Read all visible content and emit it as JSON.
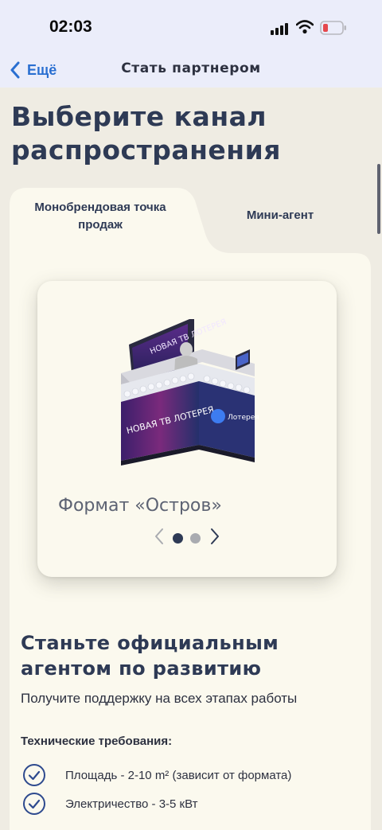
{
  "status_bar": {
    "time": "02:03"
  },
  "nav": {
    "back_label": "Ещё",
    "title": "Стать партнером"
  },
  "page": {
    "title": "Выберите канал распространения"
  },
  "tabs": [
    {
      "label": "Монобрендовая точка продаж",
      "active": true
    },
    {
      "label": "Мини-агент",
      "active": false
    }
  ],
  "card": {
    "format_label": "Формат «Остров»",
    "slides_total": 2,
    "current_slide": 1
  },
  "section": {
    "title": "Станьте официальным агентом по развитию",
    "subtitle": "Получите поддержку на всех этапах работы"
  },
  "requirements": {
    "title": "Технические требования:",
    "items": [
      "Площадь - 2-10 m² (зависит от формата)",
      "Электричество - 3-5 кВт"
    ]
  },
  "colors": {
    "accent": "#2e3a55",
    "link": "#2a6fd1",
    "background": "#efece3",
    "panel": "#fbf9ee",
    "status_bar": "#ebedfa",
    "battery_low": "#e5484d"
  },
  "icons": [
    "signal-icon",
    "wifi-icon",
    "battery-icon",
    "chevron-left-icon",
    "chevron-right-icon",
    "check-circle-icon"
  ]
}
